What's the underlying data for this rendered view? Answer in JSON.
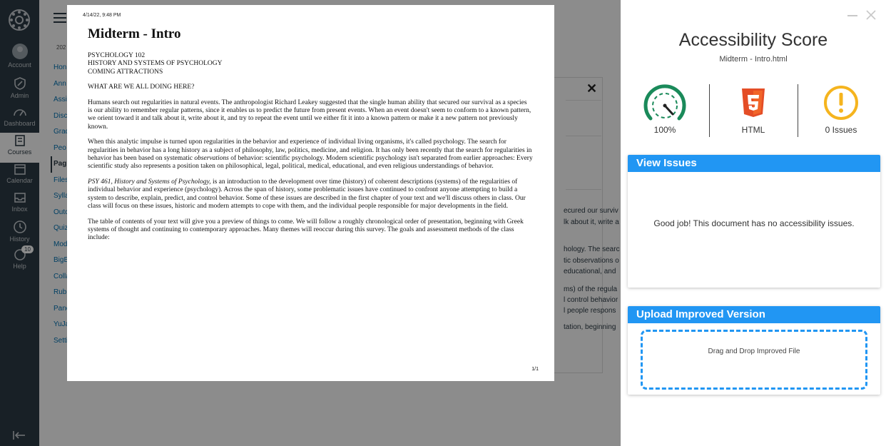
{
  "global_nav": {
    "items": [
      {
        "label": "Account",
        "icon": "account-icon"
      },
      {
        "label": "Admin",
        "icon": "admin-icon"
      },
      {
        "label": "Dashboard",
        "icon": "dashboard-icon"
      },
      {
        "label": "Courses",
        "icon": "courses-icon"
      },
      {
        "label": "Calendar",
        "icon": "calendar-icon"
      },
      {
        "label": "Inbox",
        "icon": "inbox-icon"
      },
      {
        "label": "History",
        "icon": "history-icon"
      },
      {
        "label": "Help",
        "icon": "help-icon",
        "badge": "10"
      }
    ]
  },
  "course": {
    "breadcrumb": "202",
    "nav": [
      "Hon",
      "Ann",
      "Assi",
      "Disc",
      "Grad",
      "Peo",
      "Pag",
      "Files",
      "Sylla",
      "Outc",
      "Quiz",
      "Mod",
      "BigB",
      "Colla",
      "Rubr",
      "Pano",
      "YuJa",
      "Setti"
    ],
    "bg_fragments": [
      "ecured our surviv",
      "lk about it, write a",
      "hology. The searc",
      "tic observations o",
      "educational, and",
      "ms) of the regula",
      "l control behavior",
      "l people respons",
      "tation, beginning"
    ]
  },
  "document": {
    "timestamp": "4/14/22, 9:48 PM",
    "title": "Midterm - Intro",
    "header_lines": [
      "PSYCHOLOGY 102",
      "HISTORY AND SYSTEMS OF PSYCHOLOGY",
      "COMING ATTRACTIONS"
    ],
    "heading": "WHAT ARE WE ALL DOING HERE?",
    "p1": "Humans search out regularities in natural events. The anthropologist Richard Leakey suggested that the single human ability that secured our survival as a species is our ability to remember regular patterns, since it enables us to predict the future from present events. When an event doesn't seem to conform to a known pattern, we orient toward it and talk about it, write about it, and try to repeat the event until we either fit it into a known pattern or make it a new pattern not previously known.",
    "p2_a": "When this analytic impulse is turned upon regularities in the behavior and experience of individual living organisms, it's called psychology. The search for regularities in behavior has a long history as a subject of philosophy, law, politics, medicine, and religion. It has only been recently that the search for regularities in behavior has been based on systematic ",
    "p2_em": "observations",
    "p2_b": " of behavior: scientific psychology. Modern scientific psychology isn't separated from earlier approaches: Every scientific study also represents a position taken on philosophical, legal, political, medical, educational, and even religious understandings of behavior.",
    "p3_em": "PSY 461, History and Systems of Psychology,",
    "p3_b": " is an introduction to the development over time (history) of coherent descriptions (systems) of the regularities of individual behavior and experience (psychology). Across the span of history, some problematic issues have continued to confront anyone attempting to build a system to describe, explain, predict, and control behavior. Some of these issues are described in the first chapter of your text and we'll discuss others in class. Our class will focus on these issues, historic and modern attempts to cope with them, and the individual people responsible for major developments in the field.",
    "p4": "The table of contents of your text will give you a preview of things to come. We will follow a roughly chronological order of presentation, beginning with Greek systems of thought and continuing to contemporary approaches. Many themes will reoccur during this survey. The goals and assessment methods of the class include:",
    "page": "1/1"
  },
  "panel": {
    "title": "Accessibility Score",
    "filename": "Midterm - Intro.html",
    "score": "100%",
    "score_value": 100,
    "file_type": "HTML",
    "issues": "0 Issues",
    "view_issues_title": "View Issues",
    "view_issues_message": "Good job! This document has no accessibility issues.",
    "upload_title": "Upload Improved Version",
    "dropzone_text": "Drag and Drop Improved File",
    "colors": {
      "accent": "#2196f3",
      "gauge": "#1a8a5a",
      "html5": "#e44d26",
      "warning": "#f5b41e"
    }
  }
}
